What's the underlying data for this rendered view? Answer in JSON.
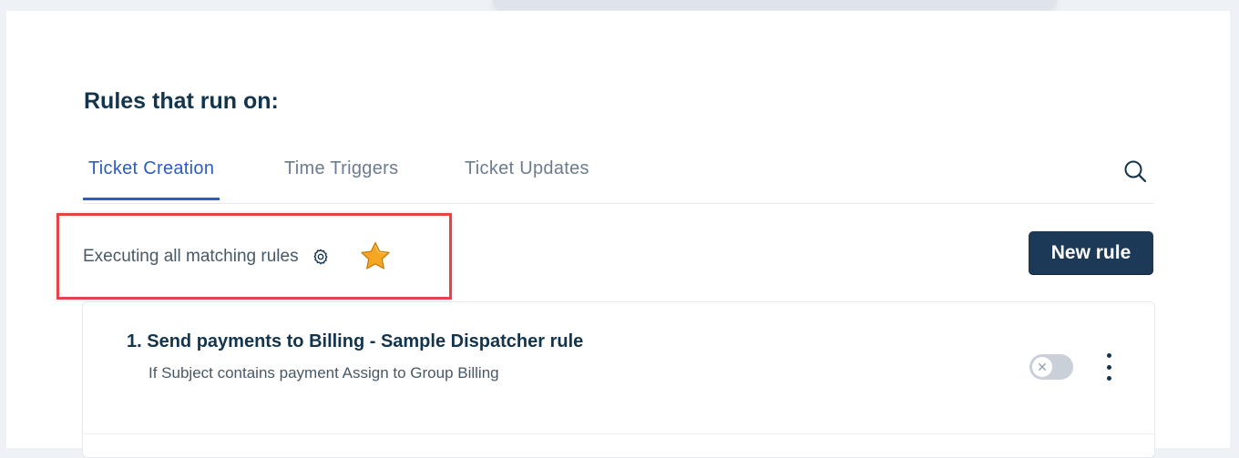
{
  "page": {
    "title": "Rules that run on:"
  },
  "tabs": [
    {
      "label": "Ticket Creation",
      "active": true
    },
    {
      "label": "Time Triggers",
      "active": false
    },
    {
      "label": "Ticket Updates",
      "active": false
    }
  ],
  "toolbar": {
    "execution_mode": "Executing all matching rules",
    "new_rule_label": "New rule"
  },
  "rules": [
    {
      "index": "1.",
      "name": "Send payments to Billing - Sample Dispatcher rule",
      "description": "If Subject contains payment Assign to Group Billing",
      "enabled": false
    }
  ],
  "icons": {
    "search": "search-icon",
    "settings": "gear-icon",
    "favorite": "star-icon",
    "toggle_off": "x-icon",
    "more": "kebab-menu-icon"
  },
  "colors": {
    "accent": "#2c5cc5",
    "primary_button": "#1c3a57",
    "highlight": "#e2444c",
    "star": "#f5a623"
  }
}
